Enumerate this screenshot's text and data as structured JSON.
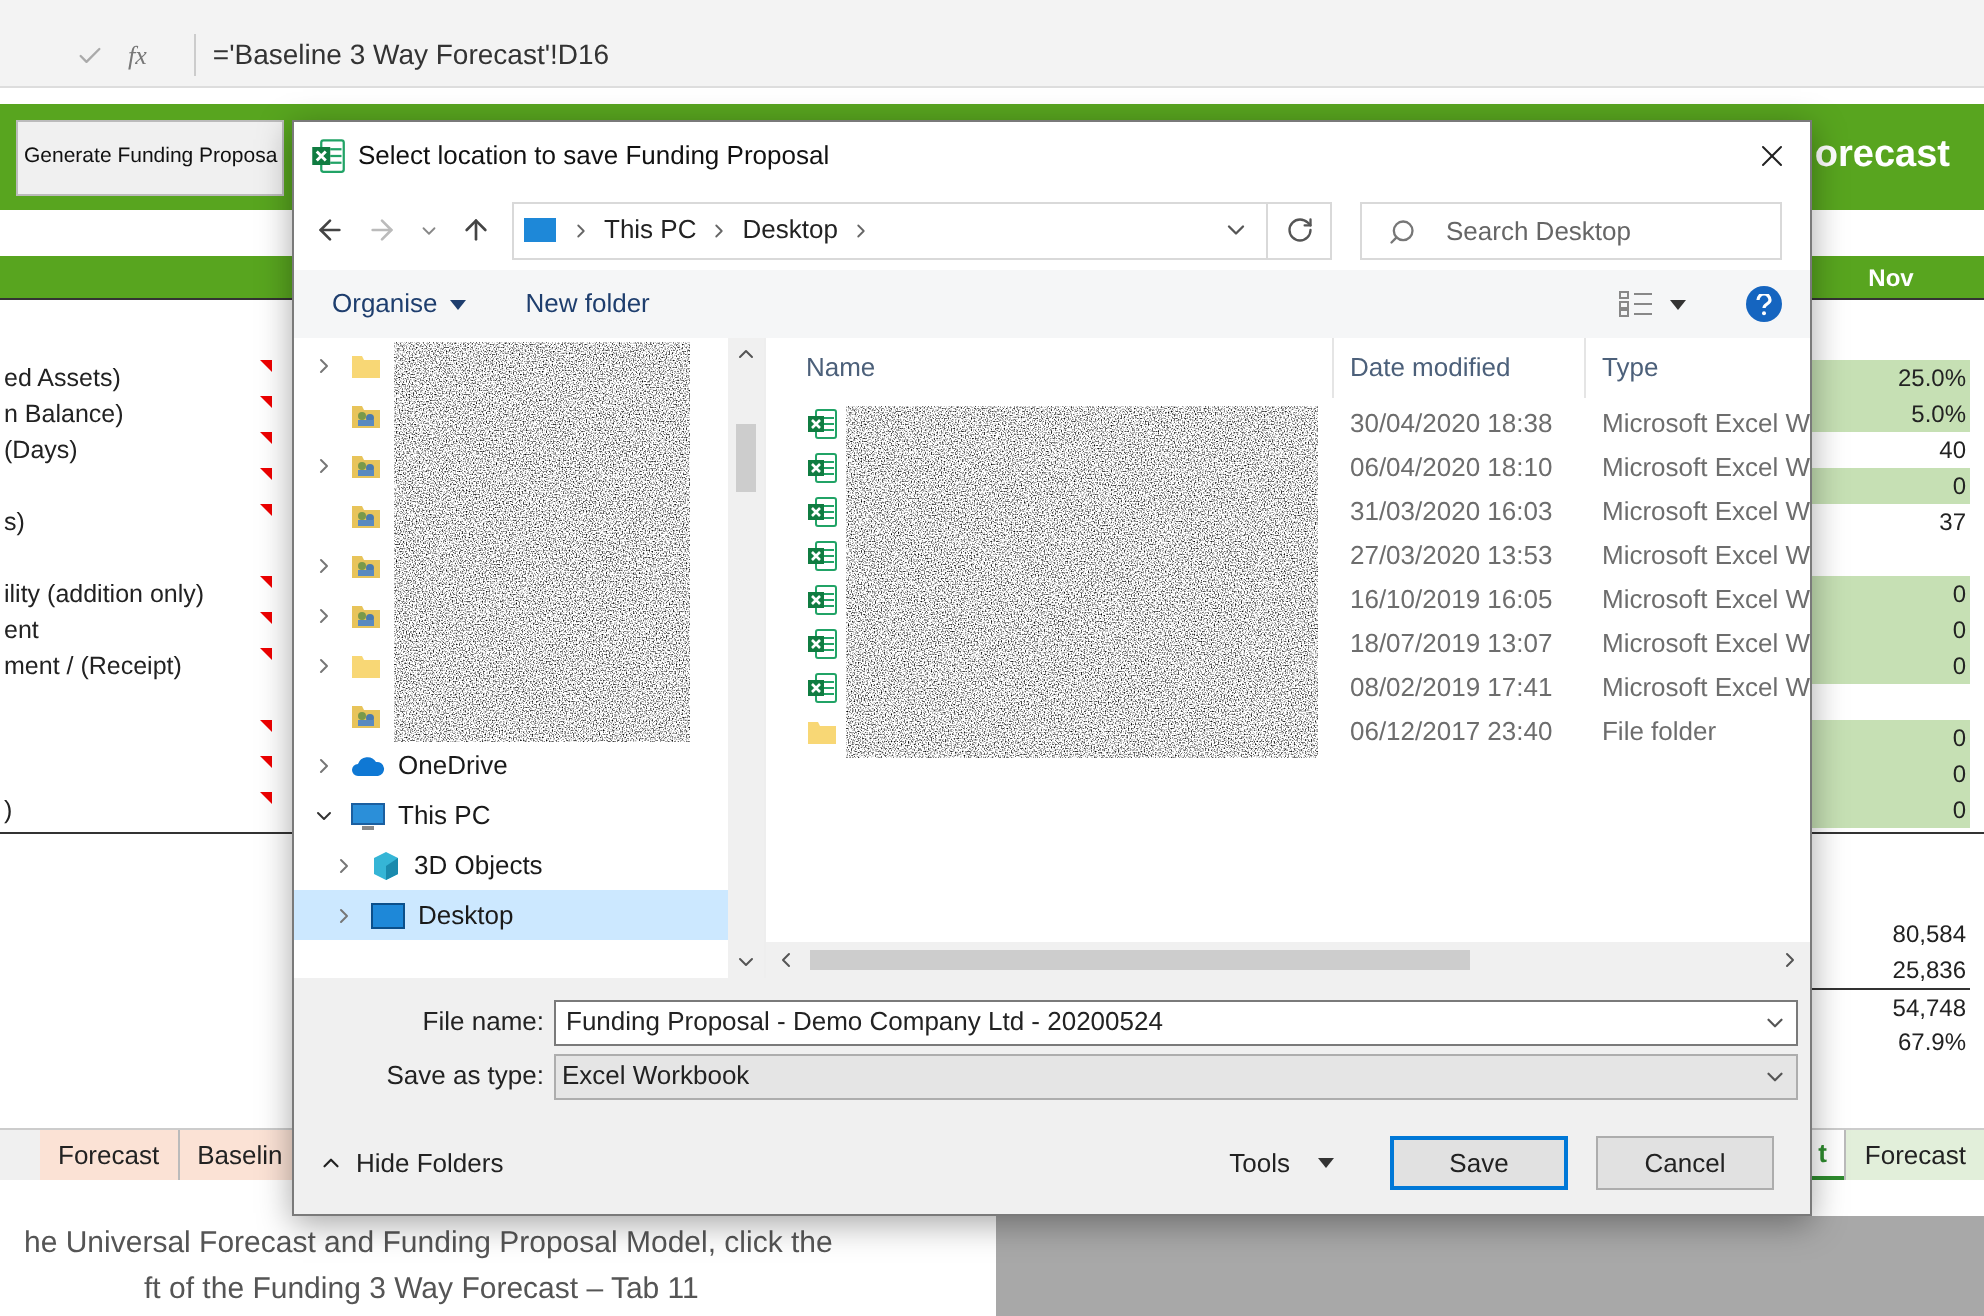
{
  "formula_bar": {
    "function_symbol": "fx",
    "formula": "='Baseline 3 Way Forecast'!D16"
  },
  "sheet": {
    "button": "Generate Funding Proposa",
    "banner_title": "orecast",
    "month_header": "Nov",
    "rows": [
      {
        "label": "ed Assets)",
        "value": "25.0%",
        "highlighted": true,
        "comment": true
      },
      {
        "label": "n Balance)",
        "value": "5.0%",
        "highlighted": true,
        "comment": true
      },
      {
        "label": "(Days)",
        "value": "40",
        "highlighted": false,
        "comment": true
      },
      {
        "value": "0",
        "highlighted": true,
        "comment": true
      },
      {
        "label": "s)",
        "value": "37",
        "highlighted": false,
        "comment": true
      },
      {
        "comment": false
      },
      {
        "label": "ility (addition only)",
        "value": "0",
        "highlighted": true,
        "comment": true
      },
      {
        "label": "ent",
        "value": "0",
        "highlighted": true,
        "comment": true
      },
      {
        "label": "ment / (Receipt)",
        "value": "0",
        "highlighted": true,
        "comment": true
      },
      {
        "comment": false
      },
      {
        "value": "0",
        "highlighted": true,
        "comment": true
      },
      {
        "value": "0",
        "highlighted": true,
        "comment": true
      },
      {
        "label": ")",
        "value": "0",
        "highlighted": true,
        "comment": true
      }
    ],
    "totals": [
      {
        "value": "80,584"
      },
      {
        "value": "25,836"
      },
      {
        "value": "54,748"
      },
      {
        "value": "67.9%"
      }
    ],
    "tabs": [
      {
        "label": "Forecast",
        "selected": false,
        "color": "#fbe2d5"
      },
      {
        "label": "Baselin",
        "selected": false,
        "color": "#fbe2d5"
      },
      {
        "label": "t",
        "selected": true,
        "color": "#2e8b2e"
      },
      {
        "label": "Forecast",
        "selected": false,
        "color": "#e2efda"
      }
    ]
  },
  "instructions": [
    "he Universal Forecast and Funding Proposal Model, click the",
    "ft of the Funding 3 Way Forecast – Tab 11"
  ],
  "dialog": {
    "title": "Select location to save Funding Proposal",
    "breadcrumb": [
      "This PC",
      "Desktop"
    ],
    "search": {
      "placeholder": "Search Desktop"
    },
    "toolbar": [
      {
        "label": "Organise",
        "menu": true
      },
      {
        "label": "New folder",
        "menu": false
      }
    ],
    "nav": [
      {
        "kind": "folder",
        "expandable": true,
        "expanded": false,
        "selected": false
      },
      {
        "kind": "shared",
        "expandable": false,
        "selected": false
      },
      {
        "kind": "shared",
        "expandable": true,
        "expanded": false,
        "selected": false
      },
      {
        "kind": "shared",
        "expandable": false,
        "selected": false
      },
      {
        "kind": "shared",
        "expandable": true,
        "expanded": false,
        "selected": false
      },
      {
        "kind": "shared",
        "expandable": true,
        "expanded": false,
        "selected": false
      },
      {
        "kind": "folder",
        "expandable": true,
        "expanded": false,
        "selected": false
      },
      {
        "kind": "shared",
        "expandable": false,
        "selected": false
      },
      {
        "kind": "cloud",
        "label": "OneDrive",
        "expandable": true,
        "expanded": false,
        "selected": false
      },
      {
        "kind": "pc",
        "label": "This PC",
        "expandable": true,
        "expanded": true,
        "selected": false,
        "children": [
          {
            "kind": "cube",
            "label": "3D Objects",
            "expandable": true,
            "expanded": false,
            "selected": false
          },
          {
            "kind": "desktop",
            "label": "Desktop",
            "expandable": true,
            "expanded": false,
            "selected": true
          }
        ]
      }
    ],
    "columns": [
      "Name",
      "Date modified",
      "Type"
    ],
    "files": [
      {
        "kind": "excel",
        "date": "30/04/2020 18:38",
        "type": "Microsoft Excel W"
      },
      {
        "kind": "excel",
        "date": "06/04/2020 18:10",
        "type": "Microsoft Excel W"
      },
      {
        "kind": "excel",
        "date": "31/03/2020 16:03",
        "type": "Microsoft Excel W"
      },
      {
        "kind": "excel",
        "date": "27/03/2020 13:53",
        "type": "Microsoft Excel W"
      },
      {
        "kind": "excel",
        "date": "16/10/2019 16:05",
        "type": "Microsoft Excel W"
      },
      {
        "kind": "excel",
        "date": "18/07/2019 13:07",
        "type": "Microsoft Excel W"
      },
      {
        "kind": "excel",
        "date": "08/02/2019 17:41",
        "type": "Microsoft Excel W"
      },
      {
        "kind": "folder",
        "date": "06/12/2017 23:40",
        "type": "File folder"
      }
    ],
    "file_name_label": "File name:",
    "file_name": "Funding Proposal - Demo Company Ltd - 20200524",
    "type_label": "Save as type:",
    "type_value": "Excel Workbook",
    "hide_folders": "Hide Folders",
    "tools": "Tools",
    "buttons": [
      {
        "label": "Save",
        "default": true
      },
      {
        "label": "Cancel",
        "default": false
      }
    ]
  }
}
